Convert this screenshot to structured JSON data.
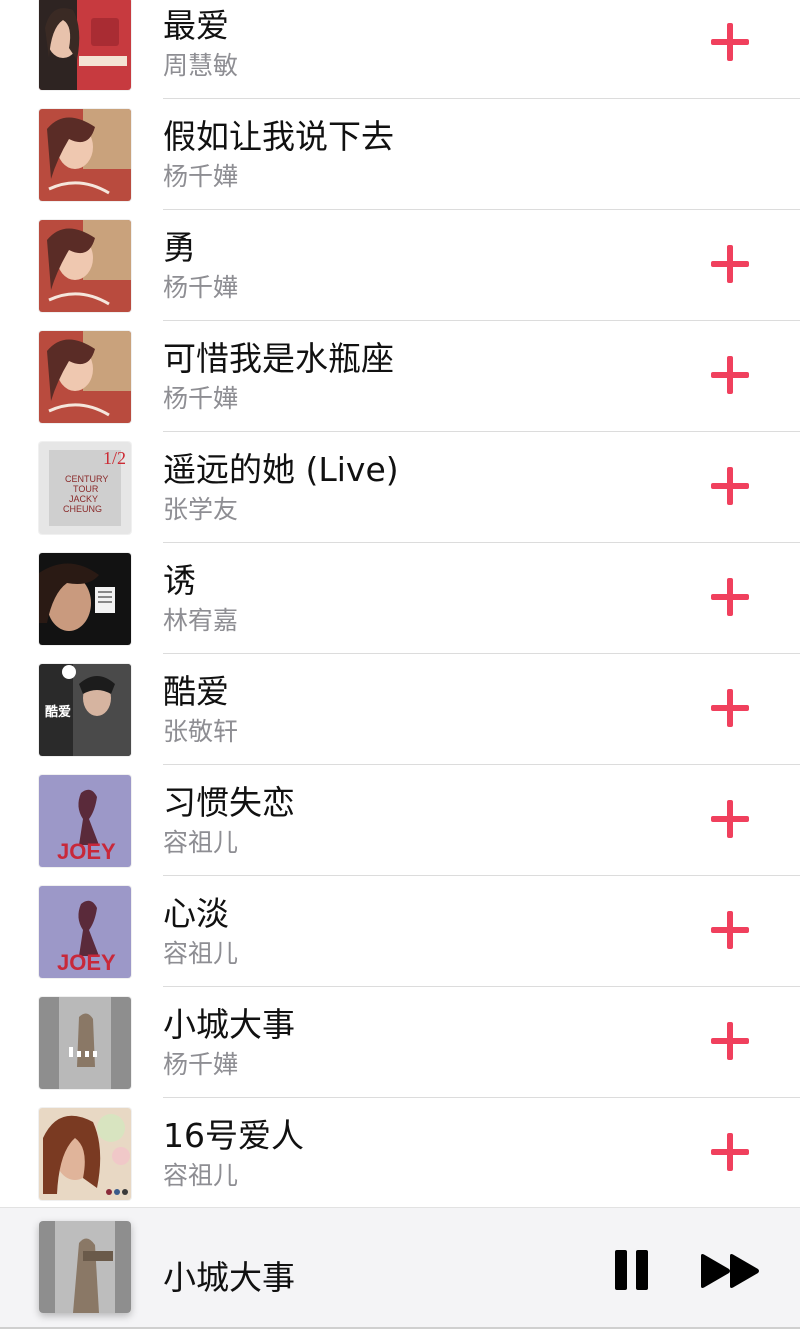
{
  "songs": [
    {
      "title": "最爱",
      "artist": "周慧敏",
      "art": "art-red-portrait",
      "has_add": true
    },
    {
      "title": "假如让我说下去",
      "artist": "杨千嬅",
      "art": "art-miriam",
      "has_add": false
    },
    {
      "title": "勇",
      "artist": "杨千嬅",
      "art": "art-miriam",
      "has_add": true
    },
    {
      "title": "可惜我是水瓶座",
      "artist": "杨千嬅",
      "art": "art-miriam",
      "has_add": true
    },
    {
      "title": "遥远的她 (Live)",
      "artist": "张学友",
      "art": "art-century-tour",
      "has_add": true
    },
    {
      "title": "诱",
      "artist": "林宥嘉",
      "art": "art-dark-portrait",
      "has_add": true
    },
    {
      "title": "酷爱",
      "artist": "张敬轩",
      "art": "art-kuai",
      "has_add": true
    },
    {
      "title": "习惯失恋",
      "artist": "容祖儿",
      "art": "art-joey-purple",
      "has_add": true
    },
    {
      "title": "心淡",
      "artist": "容祖儿",
      "art": "art-joey-purple",
      "has_add": true
    },
    {
      "title": "小城大事",
      "artist": "杨千嬅",
      "art": "art-grey-figure",
      "has_add": true
    },
    {
      "title": "16号爱人",
      "artist": "容祖儿",
      "art": "art-curly-portrait",
      "has_add": true
    }
  ],
  "art_text": {
    "century_half": "1/2",
    "century_lines": [
      "CENTURY",
      "TOUR",
      "JACKY",
      "CHEUNG"
    ],
    "kuai": "酷爱",
    "joey": "JOEY"
  },
  "now_playing": {
    "title": "小城大事",
    "art": "art-grey-figure"
  },
  "colors": {
    "accent": "#f0405d",
    "artist_text": "#8e8e93",
    "divider": "#dcdcdc",
    "player_bg": "#f4f4f6"
  },
  "icons": {
    "add": "plus-icon",
    "pause": "pause-icon",
    "next": "fast-forward-icon"
  }
}
